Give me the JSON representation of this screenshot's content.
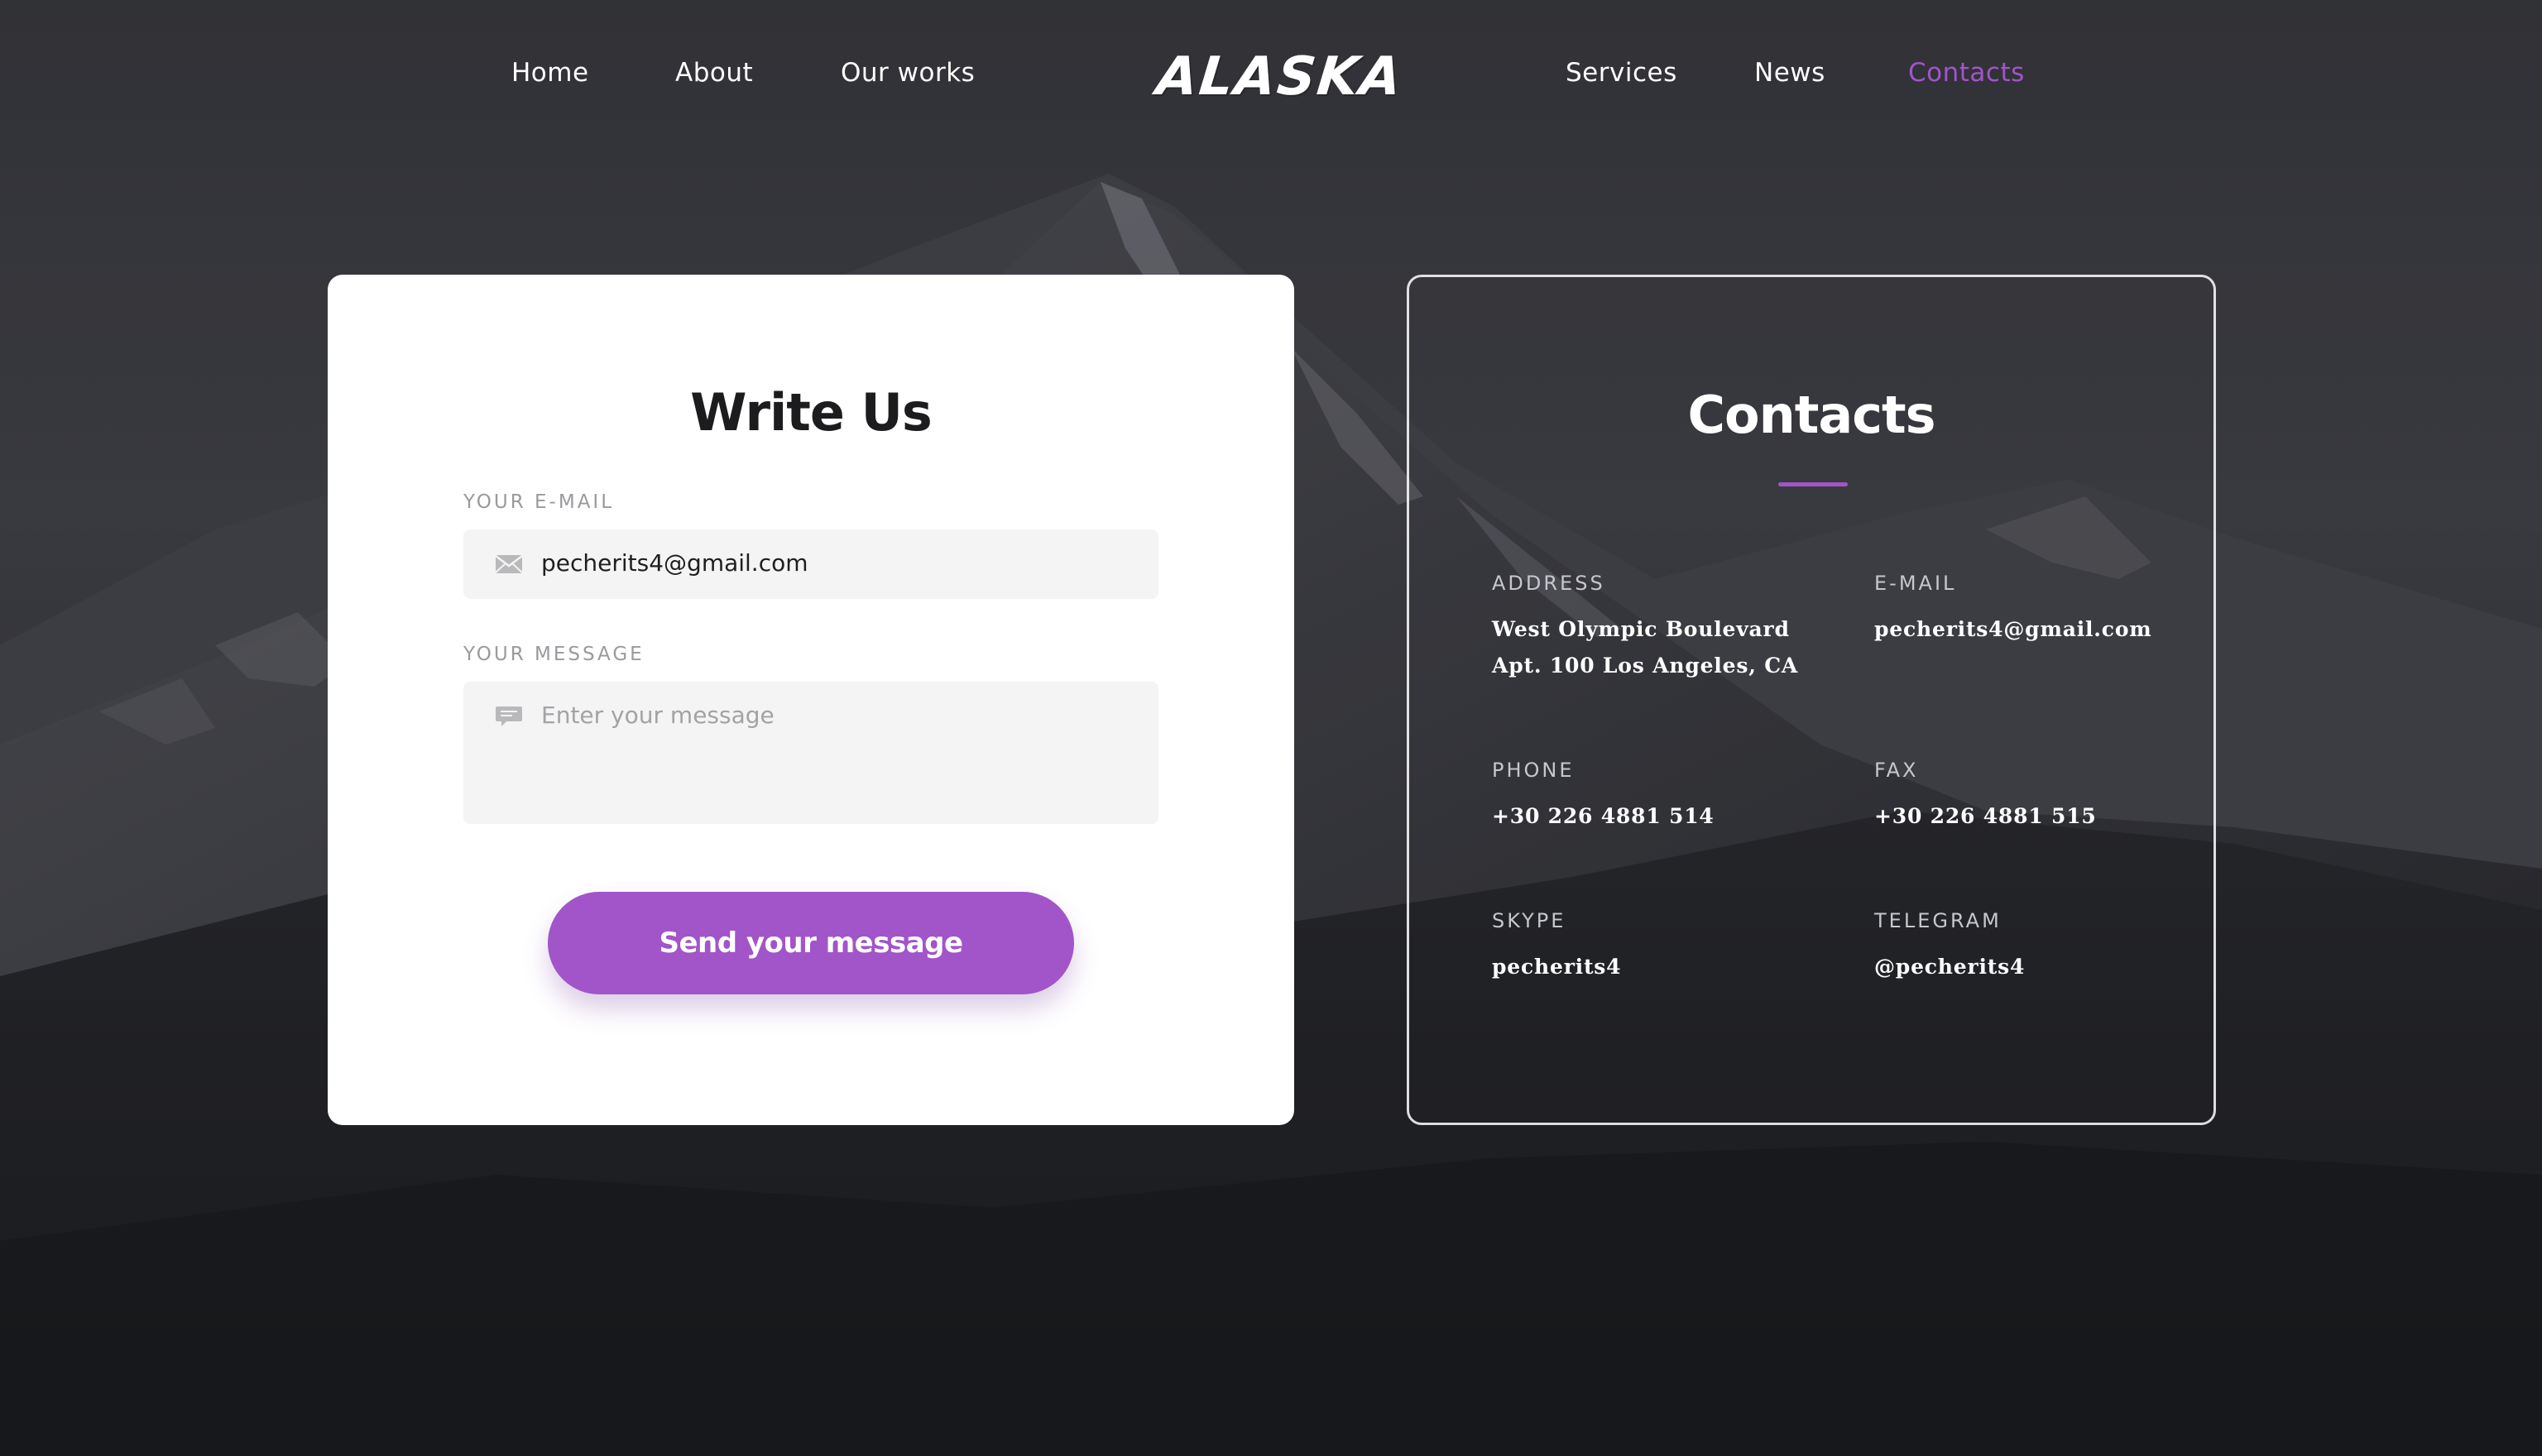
{
  "nav": {
    "left_items": [
      "Home",
      "About",
      "Our works"
    ],
    "logo": "ALASKA",
    "right_items": [
      "Services",
      "News",
      "Contacts"
    ],
    "active": "Contacts"
  },
  "write_us": {
    "title": "Write Us",
    "email_label": "YOUR E-MAIL",
    "email_value": "pecherits4@gmail.com",
    "email_icon": "mail-icon",
    "message_label": "YOUR MESSAGE",
    "message_placeholder": "Enter your message",
    "message_icon": "chat-bubble-icon",
    "send_label": "Send your message"
  },
  "contacts": {
    "title": "Contacts",
    "address_label": "ADDRESS",
    "address_value": "West Olympic Boulevard\nApt. 100 Los Angeles, CA",
    "email_label": "E-MAIL",
    "email_value": "pecherits4@gmail.com",
    "phone_label": "PHONE",
    "phone_value": "+30 226 4881 514",
    "fax_label": "FAX",
    "fax_value": "+30 226 4881 515",
    "skype_label": "SKYPE",
    "skype_value": "pecherits4",
    "telegram_label": "TELEGRAM",
    "telegram_value": "@pecherits4"
  },
  "colors": {
    "accent": "#a155c9",
    "background": "#2a2b30",
    "card": "#ffffff",
    "input_bg": "#f4f4f4"
  }
}
